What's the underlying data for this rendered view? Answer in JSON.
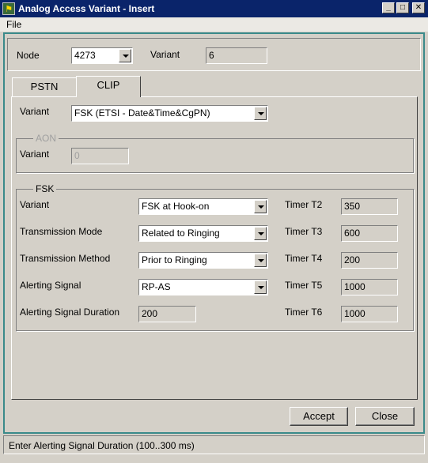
{
  "window": {
    "title": "Analog Access Variant - Insert",
    "icon": "app-icon",
    "controls": [
      "minimize-icon",
      "maximize-icon",
      "close-icon"
    ]
  },
  "menu": {
    "file": "File"
  },
  "header": {
    "node_label": "Node",
    "node_value": "4273",
    "variant_label": "Variant",
    "variant_value": "6"
  },
  "tabs": [
    {
      "label": "PSTN",
      "active": false
    },
    {
      "label": "CLIP",
      "active": true
    }
  ],
  "clip": {
    "variant_label": "Variant",
    "variant_value": "FSK (ETSI - Date&Time&CgPN)",
    "aon": {
      "title": "AON",
      "variant_label": "Variant",
      "variant_value": "0"
    },
    "fsk": {
      "title": "FSK",
      "variant_label": "Variant",
      "variant_value": "FSK at Hook-on",
      "transmission_mode_label": "Transmission Mode",
      "transmission_mode_value": "Related to Ringing",
      "transmission_method_label": "Transmission Method",
      "transmission_method_value": "Prior to Ringing",
      "alerting_signal_label": "Alerting Signal",
      "alerting_signal_value": "RP-AS",
      "alerting_duration_label": "Alerting Signal Duration",
      "alerting_duration_value": "200",
      "timers": [
        {
          "label": "Timer T2",
          "value": "350"
        },
        {
          "label": "Timer T3",
          "value": "600"
        },
        {
          "label": "Timer T4",
          "value": "200"
        },
        {
          "label": "Timer T5",
          "value": "1000"
        },
        {
          "label": "Timer T6",
          "value": "1000"
        }
      ]
    }
  },
  "buttons": {
    "accept": "Accept",
    "close": "Close"
  },
  "status": {
    "text": "Enter Alerting Signal Duration (100..300 ms)"
  }
}
